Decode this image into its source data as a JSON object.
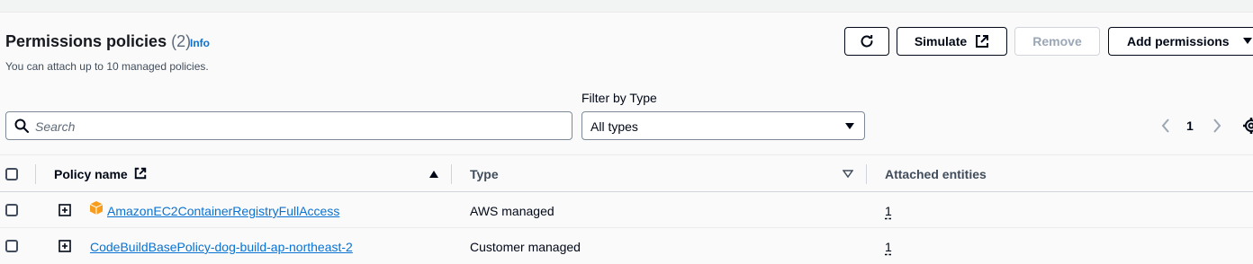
{
  "header": {
    "title": "Permissions policies",
    "count": "(2)",
    "info": "Info",
    "description": "You can attach up to 10 managed policies."
  },
  "toolbar": {
    "refresh_icon": "refresh-icon",
    "simulate_label": "Simulate",
    "remove_label": "Remove",
    "add_permissions_label": "Add permissions"
  },
  "filters": {
    "search_placeholder": "Search",
    "filter_by_type_label": "Filter by Type",
    "type_selected": "All types"
  },
  "pagination": {
    "current_page": "1"
  },
  "table": {
    "columns": {
      "policy_name": "Policy name",
      "type": "Type",
      "attached_entities": "Attached entities"
    },
    "rows": [
      {
        "name": "AmazonEC2ContainerRegistryFullAccess",
        "type": "AWS managed",
        "attached": "1",
        "icon": "aws-managed-cube-icon"
      },
      {
        "name": "CodeBuildBasePolicy-dog-build-ap-northeast-2",
        "type": "Customer managed",
        "attached": "1"
      }
    ]
  },
  "colors": {
    "link": "#0972d3",
    "border_dark": "#000716",
    "aws_orange": "#f89c1c"
  }
}
